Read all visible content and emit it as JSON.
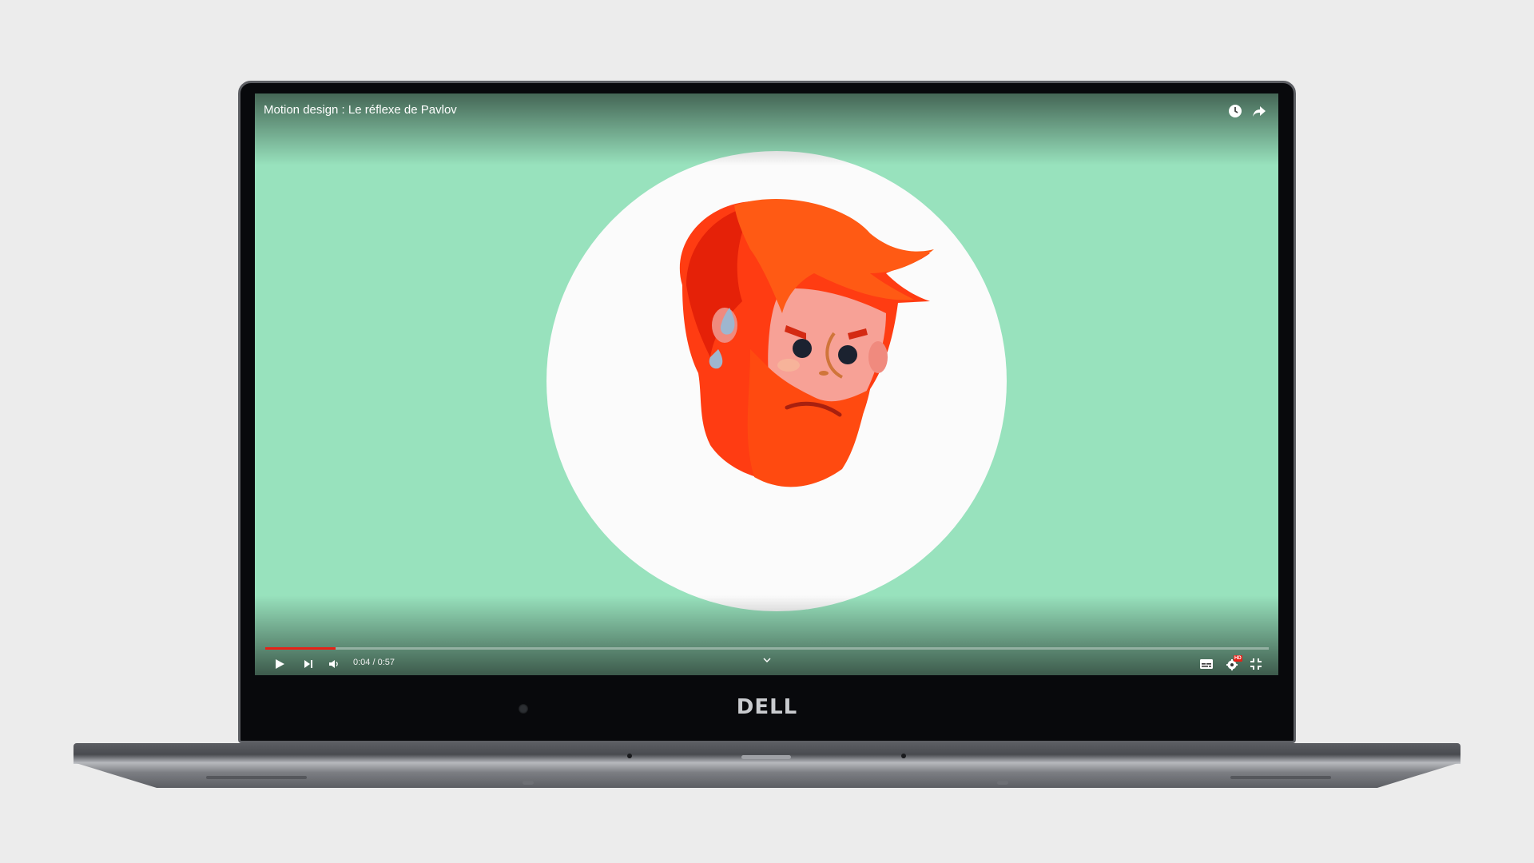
{
  "video": {
    "title": "Motion design : Le réflexe de Pavlov",
    "current_time": "0:04",
    "duration": "0:57",
    "progress_fraction": 0.07,
    "quality_badge": "HD"
  },
  "device": {
    "brand": "DELL"
  },
  "controls": {
    "play_icon": "play-icon",
    "next_icon": "next-icon",
    "volume_icon": "volume-icon",
    "subtitles_icon": "subtitles-icon",
    "settings_icon": "settings-icon",
    "exit_fullscreen_icon": "exit-fullscreen-icon",
    "watch_later_icon": "clock-icon",
    "share_icon": "share-icon",
    "expand_icon": "chevron-down-icon"
  },
  "colors": {
    "background": "#98e2bd",
    "progress": "#e62117",
    "circle": "#fbfbfb",
    "hair": "#ff3c12"
  }
}
